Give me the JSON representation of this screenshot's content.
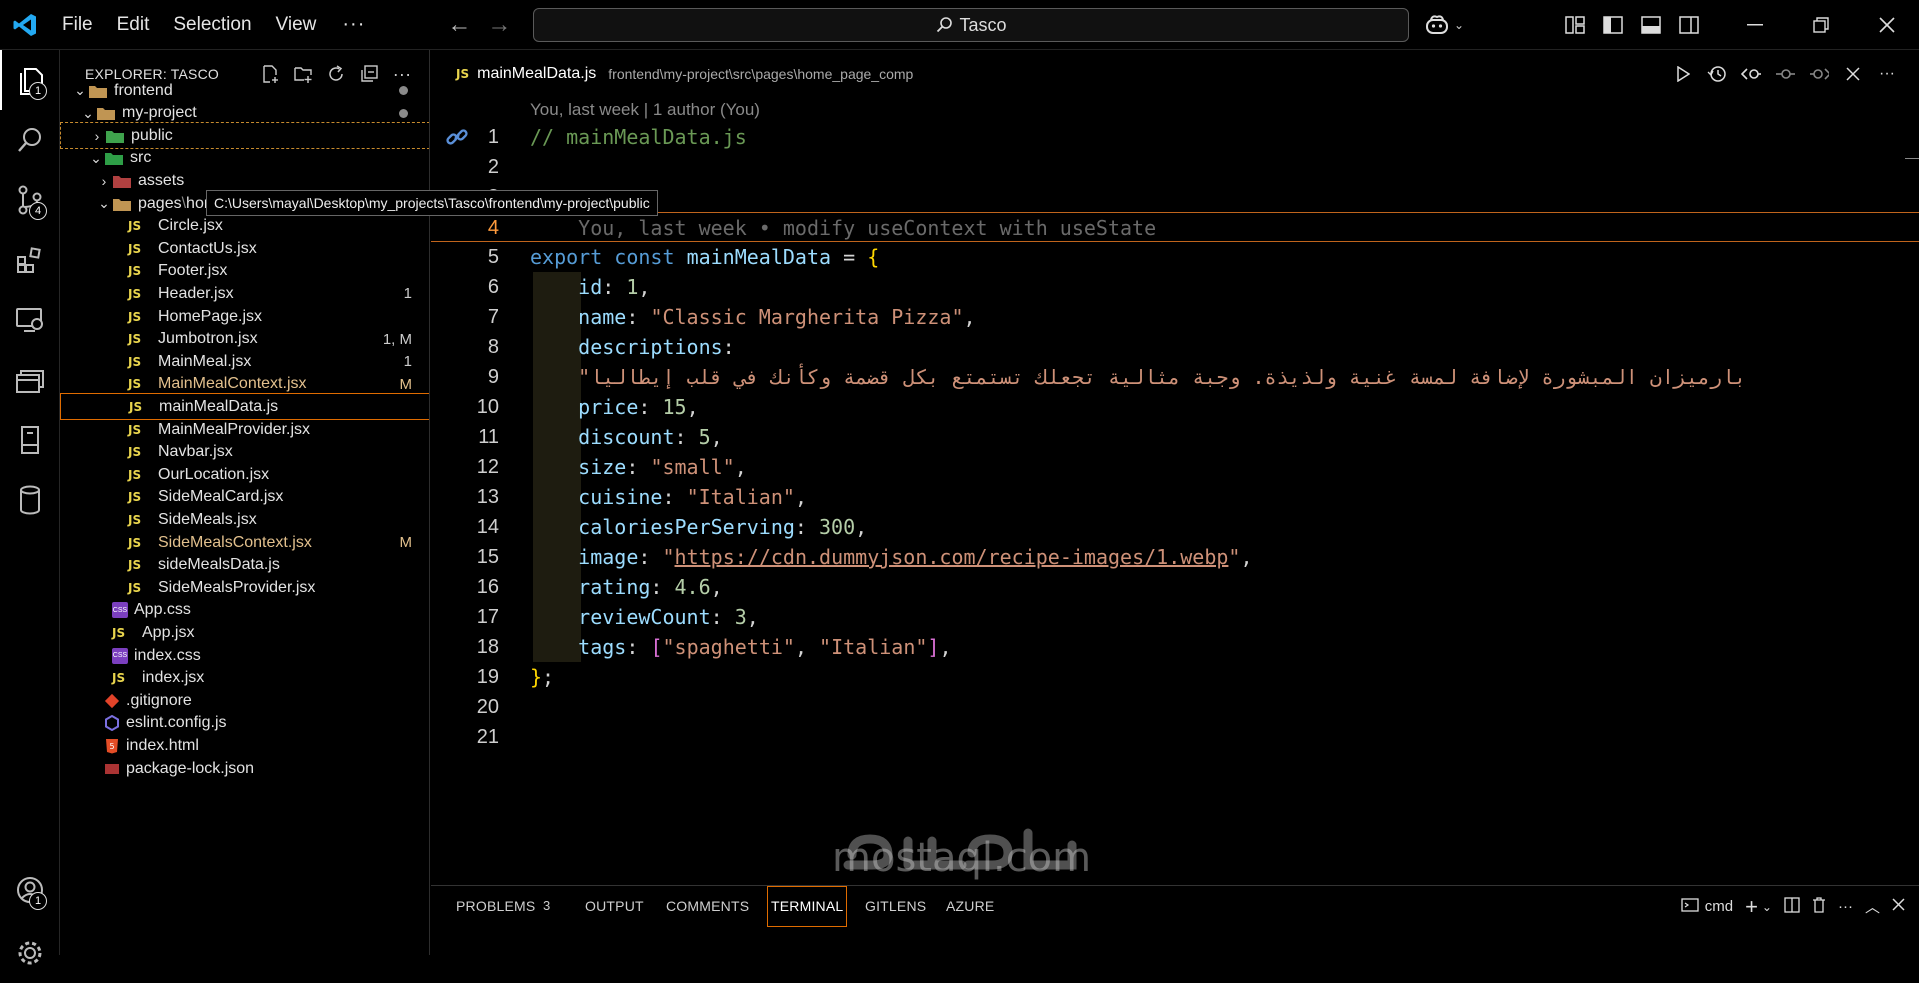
{
  "menu": [
    "File",
    "Edit",
    "Selection",
    "View"
  ],
  "command_center": {
    "label": "Tasco"
  },
  "sidebar": {
    "title": "EXPLORER: TASCO",
    "tooltip": "C:\\Users\\mayal\\Desktop\\my_projects\\Tasco\\frontend\\my-project\\public"
  },
  "tree": [
    {
      "label": "frontend",
      "kind": "folder-open",
      "depth": 0,
      "dot": true
    },
    {
      "label": "my-project",
      "kind": "folder-open",
      "depth": 1,
      "dot": true
    },
    {
      "label": "public",
      "kind": "folder-public",
      "depth": 2
    },
    {
      "label": "src",
      "kind": "folder-src",
      "depth": 2
    },
    {
      "label": "assets",
      "kind": "folder-assets",
      "depth": 3
    },
    {
      "label": "pages",
      "label2": "home_page_comp",
      "kind": "folder-open",
      "depth": 3,
      "dot": true
    },
    {
      "label": "Circle.jsx",
      "kind": "js",
      "depth": 4
    },
    {
      "label": "ContactUs.jsx",
      "kind": "js",
      "depth": 4
    },
    {
      "label": "Footer.jsx",
      "kind": "js",
      "depth": 4
    },
    {
      "label": "Header.jsx",
      "kind": "js",
      "depth": 4,
      "badge": "1"
    },
    {
      "label": "HomePage.jsx",
      "kind": "js",
      "depth": 4
    },
    {
      "label": "Jumbotron.jsx",
      "kind": "js",
      "depth": 4,
      "badge": "1, M"
    },
    {
      "label": "MainMeal.jsx",
      "kind": "js",
      "depth": 4,
      "badge": "1"
    },
    {
      "label": "MainMealContext.jsx",
      "kind": "js",
      "depth": 4,
      "badge": "M",
      "modified": true
    },
    {
      "label": "mainMealData.js",
      "kind": "js",
      "depth": 4,
      "selected": true
    },
    {
      "label": "MainMealProvider.jsx",
      "kind": "js",
      "depth": 4
    },
    {
      "label": "Navbar.jsx",
      "kind": "js",
      "depth": 4
    },
    {
      "label": "OurLocation.jsx",
      "kind": "js",
      "depth": 4
    },
    {
      "label": "SideMealCard.jsx",
      "kind": "js",
      "depth": 4
    },
    {
      "label": "SideMeals.jsx",
      "kind": "js",
      "depth": 4
    },
    {
      "label": "SideMealsContext.jsx",
      "kind": "js",
      "depth": 4,
      "badge": "M",
      "modified": true
    },
    {
      "label": "sideMealsData.js",
      "kind": "js",
      "depth": 4
    },
    {
      "label": "SideMealsProvider.jsx",
      "kind": "js",
      "depth": 4
    },
    {
      "label": "App.css",
      "kind": "css",
      "depth": 3
    },
    {
      "label": "App.jsx",
      "kind": "js",
      "depth": 3
    },
    {
      "label": "index.css",
      "kind": "css",
      "depth": 3
    },
    {
      "label": "index.jsx",
      "kind": "js",
      "depth": 3
    },
    {
      "label": ".gitignore",
      "kind": "git",
      "depth": 2
    },
    {
      "label": "eslint.config.js",
      "kind": "eslint",
      "depth": 2
    },
    {
      "label": "index.html",
      "kind": "html",
      "depth": 2
    },
    {
      "label": "package-lock.json",
      "kind": "json",
      "depth": 2
    }
  ],
  "activity_badges": {
    "explorer": "1",
    "source_control": "4",
    "accounts": "1"
  },
  "tab": {
    "icon": "JS",
    "name": "mainMealData.js",
    "path": "frontend\\my-project\\src\\pages\\home_page_comp"
  },
  "editor": {
    "codelens": "You, last week | 1 author (You)",
    "current_line": 4,
    "lines": [
      {
        "n": "1",
        "tokens": [
          [
            "c-cm",
            "// mainMealData.js"
          ]
        ]
      },
      {
        "n": "2",
        "tokens": []
      },
      {
        "n": "3",
        "tokens": []
      },
      {
        "n": "4",
        "tokens": [
          [
            "blame",
            "    You, last week • modify useContext with useState"
          ]
        ]
      },
      {
        "n": "5",
        "tokens": [
          [
            "c-kw",
            "export"
          ],
          [
            "",
            " "
          ],
          [
            "c-kw",
            "const"
          ],
          [
            "",
            " "
          ],
          [
            "c-var",
            "mainMealData"
          ],
          [
            "",
            " = "
          ],
          [
            "c-br",
            "{"
          ]
        ]
      },
      {
        "n": "6",
        "tokens": [
          [
            "",
            "    "
          ],
          [
            "c-var",
            "id"
          ],
          [
            "",
            ": "
          ],
          [
            "c-num",
            "1"
          ],
          [
            "",
            ","
          ]
        ]
      },
      {
        "n": "7",
        "tokens": [
          [
            "",
            "    "
          ],
          [
            "c-var",
            "name"
          ],
          [
            "",
            ": "
          ],
          [
            "c-str",
            "\"Classic Margherita Pizza\""
          ],
          [
            "",
            ","
          ]
        ]
      },
      {
        "n": "8",
        "tokens": [
          [
            "",
            "    "
          ],
          [
            "c-var",
            "descriptions"
          ],
          [
            "",
            ":"
          ]
        ]
      },
      {
        "n": "9",
        "tokens": [
          [
            "",
            "    "
          ],
          [
            "c-str",
            "\"بارميزان المبشورة لإضافة لمسة غنية ولذيذة. وجبة مثالية تجعلك تستمتع بكل قضمة وكأنك في قلب إيطاليا"
          ]
        ]
      },
      {
        "n": "10",
        "tokens": [
          [
            "",
            "    "
          ],
          [
            "c-var",
            "price"
          ],
          [
            "",
            ": "
          ],
          [
            "c-num",
            "15"
          ],
          [
            "",
            ","
          ]
        ]
      },
      {
        "n": "11",
        "tokens": [
          [
            "",
            "    "
          ],
          [
            "c-var",
            "discount"
          ],
          [
            "",
            ": "
          ],
          [
            "c-num",
            "5"
          ],
          [
            "",
            ","
          ]
        ]
      },
      {
        "n": "12",
        "tokens": [
          [
            "",
            "    "
          ],
          [
            "c-var",
            "size"
          ],
          [
            "",
            ": "
          ],
          [
            "c-str",
            "\"small\""
          ],
          [
            "",
            ","
          ]
        ]
      },
      {
        "n": "13",
        "tokens": [
          [
            "",
            "    "
          ],
          [
            "c-var",
            "cuisine"
          ],
          [
            "",
            ": "
          ],
          [
            "c-str",
            "\"Italian\""
          ],
          [
            "",
            ","
          ]
        ]
      },
      {
        "n": "14",
        "tokens": [
          [
            "",
            "    "
          ],
          [
            "c-var",
            "caloriesPerServing"
          ],
          [
            "",
            ": "
          ],
          [
            "c-num",
            "300"
          ],
          [
            "",
            ","
          ]
        ]
      },
      {
        "n": "15",
        "tokens": [
          [
            "",
            "    "
          ],
          [
            "c-var",
            "image"
          ],
          [
            "",
            ": "
          ],
          [
            "c-str",
            "\""
          ],
          [
            "c-str c-url",
            "https://cdn.dummyjson.com/recipe-images/1.webp"
          ],
          [
            "c-str",
            "\""
          ],
          [
            "",
            ","
          ]
        ]
      },
      {
        "n": "16",
        "tokens": [
          [
            "",
            "    "
          ],
          [
            "c-var",
            "rating"
          ],
          [
            "",
            ": "
          ],
          [
            "c-num",
            "4.6"
          ],
          [
            "",
            ","
          ]
        ]
      },
      {
        "n": "17",
        "tokens": [
          [
            "",
            "    "
          ],
          [
            "c-var",
            "reviewCount"
          ],
          [
            "",
            ": "
          ],
          [
            "c-num",
            "3"
          ],
          [
            "",
            ","
          ]
        ]
      },
      {
        "n": "18",
        "tokens": [
          [
            "",
            "    "
          ],
          [
            "c-var",
            "tags"
          ],
          [
            "",
            ": "
          ],
          [
            "c-br2",
            "["
          ],
          [
            "c-str",
            "\"spaghetti\""
          ],
          [
            "",
            ", "
          ],
          [
            "c-str",
            "\"Italian\""
          ],
          [
            "c-br2",
            "]"
          ],
          [
            "",
            ","
          ]
        ]
      },
      {
        "n": "19",
        "tokens": [
          [
            "c-br",
            "}"
          ],
          [
            "",
            ";"
          ]
        ]
      },
      {
        "n": "20",
        "tokens": []
      },
      {
        "n": "21",
        "tokens": []
      }
    ]
  },
  "panel": {
    "tabs": [
      {
        "label": "PROBLEMS",
        "count": "3"
      },
      {
        "label": "OUTPUT"
      },
      {
        "label": "COMMENTS"
      },
      {
        "label": "TERMINAL",
        "active": true
      },
      {
        "label": "GITLENS"
      },
      {
        "label": "AZURE"
      }
    ],
    "shell": "cmd"
  },
  "watermark": {
    "text": "mostaql.com"
  }
}
